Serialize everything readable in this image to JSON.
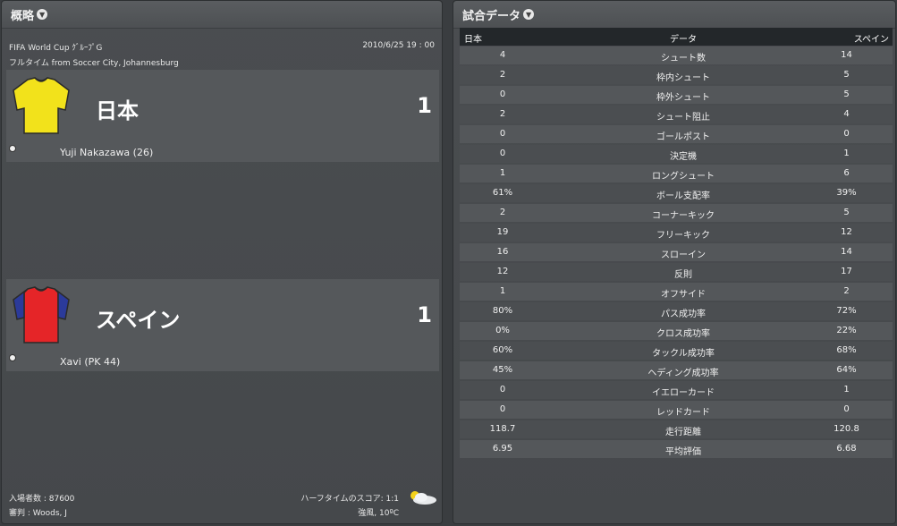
{
  "overview": {
    "title": "概略",
    "competition": "FIFA World Cup ｸﾞﾙｰﾌﾟG",
    "datetime": "2010/6/25 19 : 00",
    "status": "フルタイム from Soccer City, Johannesburg",
    "home": {
      "name": "日本",
      "score": "1",
      "scorer": "Yuji Nakazawa (26)",
      "shirt_color": "#f2e21b",
      "sleeve_color": "#f2e21b"
    },
    "away": {
      "name": "スペイン",
      "score": "1",
      "scorer": "Xavi (PK 44)",
      "shirt_color": "#e52528",
      "sleeve_color": "#2b3a9a"
    },
    "attendance": "入場者数 :   87600",
    "referee": "審判 :   Woods, J",
    "halftime": "ハーフタイムのスコア: 1:1",
    "weather": "強風, 10ºC"
  },
  "stats": {
    "title": "試合データ",
    "headers": {
      "home": "日本",
      "label": "データ",
      "away": "スペイン"
    },
    "rows": [
      {
        "home": "4",
        "label": "シュート数",
        "away": "14"
      },
      {
        "home": "2",
        "label": "枠内シュート",
        "away": "5"
      },
      {
        "home": "0",
        "label": "枠外シュート",
        "away": "5"
      },
      {
        "home": "2",
        "label": "シュート阻止",
        "away": "4"
      },
      {
        "home": "0",
        "label": "ゴールポスト",
        "away": "0"
      },
      {
        "home": "0",
        "label": "決定機",
        "away": "1"
      },
      {
        "home": "1",
        "label": "ロングシュート",
        "away": "6"
      },
      {
        "home": "61%",
        "label": "ボール支配率",
        "away": "39%"
      },
      {
        "home": "2",
        "label": "コーナーキック",
        "away": "5"
      },
      {
        "home": "19",
        "label": "フリーキック",
        "away": "12"
      },
      {
        "home": "16",
        "label": "スローイン",
        "away": "14"
      },
      {
        "home": "12",
        "label": "反則",
        "away": "17"
      },
      {
        "home": "1",
        "label": "オフサイド",
        "away": "2"
      },
      {
        "home": "80%",
        "label": "パス成功率",
        "away": "72%"
      },
      {
        "home": "0%",
        "label": "クロス成功率",
        "away": "22%"
      },
      {
        "home": "60%",
        "label": "タックル成功率",
        "away": "68%"
      },
      {
        "home": "45%",
        "label": "ヘディング成功率",
        "away": "64%"
      },
      {
        "home": "0",
        "label": "イエローカード",
        "away": "1"
      },
      {
        "home": "0",
        "label": "レッドカード",
        "away": "0"
      },
      {
        "home": "118.7",
        "label": "走行距離",
        "away": "120.8"
      },
      {
        "home": "6.95",
        "label": "平均評価",
        "away": "6.68"
      }
    ]
  }
}
